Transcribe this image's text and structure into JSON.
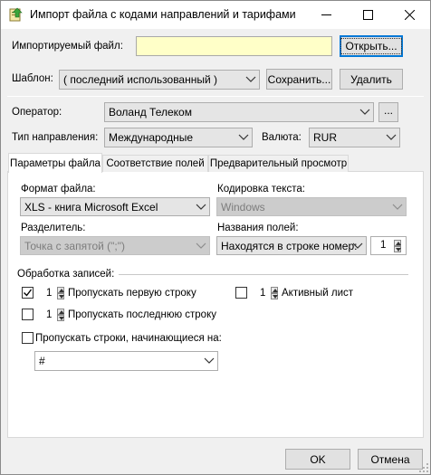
{
  "window": {
    "title": "Импорт файла с кодами направлений и тарифами"
  },
  "file": {
    "label": "Импортируемый файл:",
    "value": "",
    "open_button": "Открыть..."
  },
  "template": {
    "label": "Шаблон:",
    "value": "( последний использованный )",
    "save_button": "Сохранить...",
    "delete_button": "Удалить"
  },
  "operator": {
    "label": "Оператор:",
    "value": "Воланд Телеком",
    "more_button": "..."
  },
  "direction": {
    "label": "Тип направления:",
    "value": "Международные"
  },
  "currency": {
    "label": "Валюта:",
    "value": "RUR"
  },
  "tabs": [
    {
      "label": "Параметры файла",
      "active": true
    },
    {
      "label": "Соответствие полей",
      "active": false
    },
    {
      "label": "Предварительный просмотр",
      "active": false
    }
  ],
  "params": {
    "format_label": "Формат файла:",
    "format_value": "XLS - книга Microsoft Excel",
    "encoding_label": "Кодировка текста:",
    "encoding_value": "Windows",
    "separator_label": "Разделитель:",
    "separator_value": "Точка с запятой (\";\")",
    "fieldnames_label": "Названия полей:",
    "fieldnames_value": "Находятся в строке номер:",
    "fieldnames_row": "1"
  },
  "processing": {
    "group_label": "Обработка записей:",
    "skip_first": {
      "checked": true,
      "count": "1",
      "label": "Пропускать первую строку"
    },
    "active_sheet": {
      "checked": false,
      "count": "1",
      "label": "Активный лист"
    },
    "skip_last": {
      "checked": false,
      "count": "1",
      "label": "Пропускать последнюю строку"
    },
    "skip_prefix": {
      "checked": false,
      "label": "Пропускать строки, начинающиеся на:",
      "value": "#"
    }
  },
  "footer": {
    "ok": "OK",
    "cancel": "Отмена"
  }
}
